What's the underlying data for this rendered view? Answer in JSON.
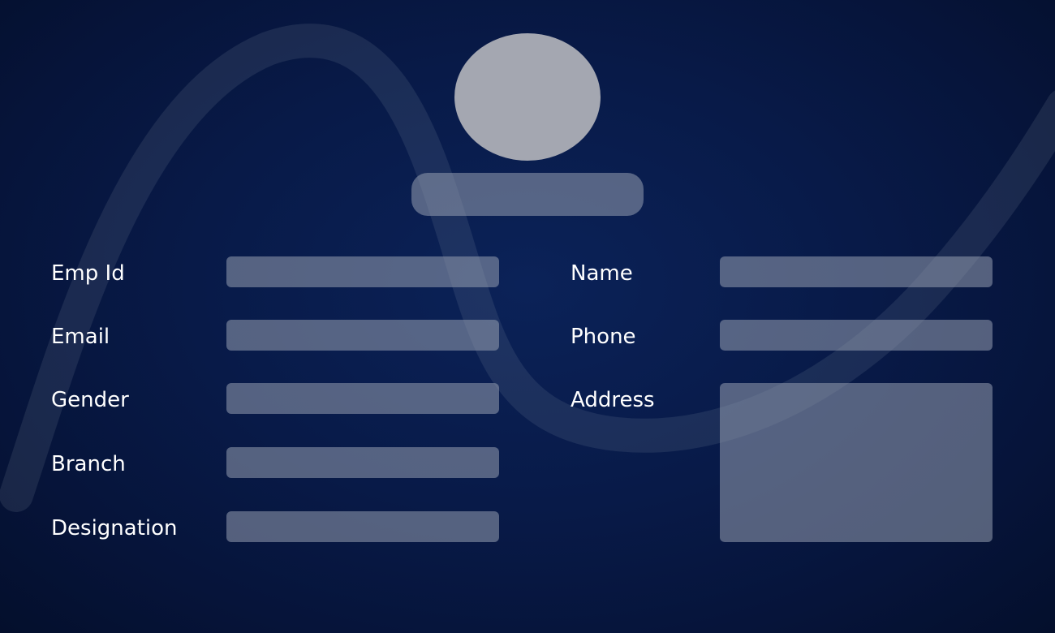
{
  "profile": {
    "avatar_icon": "user-avatar-placeholder",
    "name_value": ""
  },
  "form": {
    "emp_id": {
      "label": "Emp Id",
      "value": "",
      "placeholder": ""
    },
    "email": {
      "label": "Email",
      "value": "",
      "placeholder": ""
    },
    "gender": {
      "label": "Gender",
      "value": "",
      "placeholder": ""
    },
    "branch": {
      "label": "Branch",
      "value": "",
      "placeholder": ""
    },
    "designation": {
      "label": "Designation",
      "value": "",
      "placeholder": ""
    },
    "name": {
      "label": "Name",
      "value": "",
      "placeholder": ""
    },
    "phone": {
      "label": "Phone",
      "value": "",
      "placeholder": ""
    },
    "address": {
      "label": "Address",
      "value": "",
      "placeholder": ""
    }
  },
  "colors": {
    "background": "#081a48",
    "field_fill": "#5f6780",
    "avatar_fill": "#a4a7b1",
    "label_text": "#ffffff"
  }
}
